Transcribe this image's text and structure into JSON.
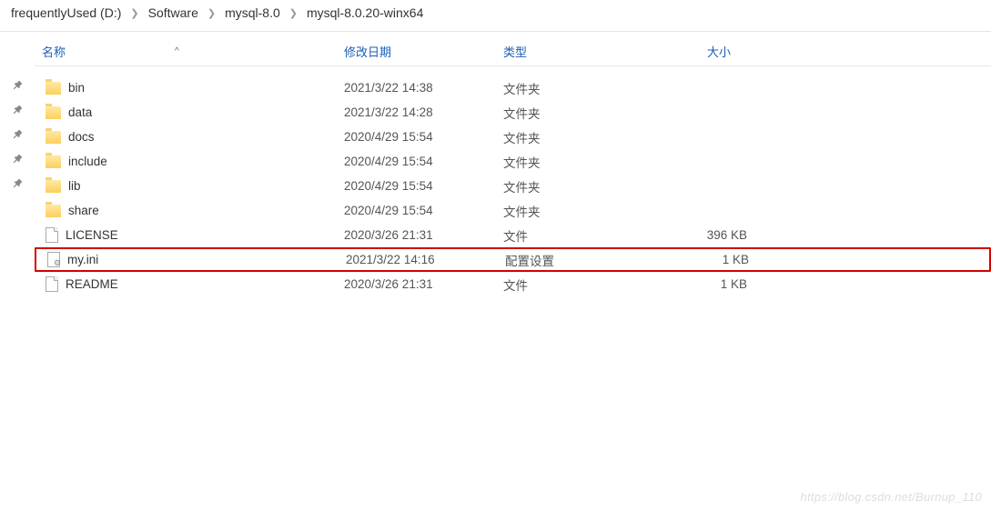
{
  "breadcrumb": [
    "frequentlyUsed (D:)",
    "Software",
    "mysql-8.0",
    "mysql-8.0.20-winx64"
  ],
  "columns": {
    "name": "名称",
    "date": "修改日期",
    "type": "类型",
    "size": "大小",
    "sort_indicator": "^"
  },
  "files": [
    {
      "icon": "folder",
      "name": "bin",
      "date": "2021/3/22 14:38",
      "type": "文件夹",
      "size": "",
      "highlight": false
    },
    {
      "icon": "folder",
      "name": "data",
      "date": "2021/3/22 14:28",
      "type": "文件夹",
      "size": "",
      "highlight": false
    },
    {
      "icon": "folder",
      "name": "docs",
      "date": "2020/4/29 15:54",
      "type": "文件夹",
      "size": "",
      "highlight": false
    },
    {
      "icon": "folder",
      "name": "include",
      "date": "2020/4/29 15:54",
      "type": "文件夹",
      "size": "",
      "highlight": false
    },
    {
      "icon": "folder",
      "name": "lib",
      "date": "2020/4/29 15:54",
      "type": "文件夹",
      "size": "",
      "highlight": false
    },
    {
      "icon": "folder",
      "name": "share",
      "date": "2020/4/29 15:54",
      "type": "文件夹",
      "size": "",
      "highlight": false
    },
    {
      "icon": "file",
      "name": "LICENSE",
      "date": "2020/3/26 21:31",
      "type": "文件",
      "size": "396 KB",
      "highlight": false
    },
    {
      "icon": "ini",
      "name": "my.ini",
      "date": "2021/3/22 14:16",
      "type": "配置设置",
      "size": "1 KB",
      "highlight": true
    },
    {
      "icon": "file",
      "name": "README",
      "date": "2020/3/26 21:31",
      "type": "文件",
      "size": "1 KB",
      "highlight": false
    }
  ],
  "pin_count": 5,
  "watermark": "https://blog.csdn.net/Burnup_110"
}
